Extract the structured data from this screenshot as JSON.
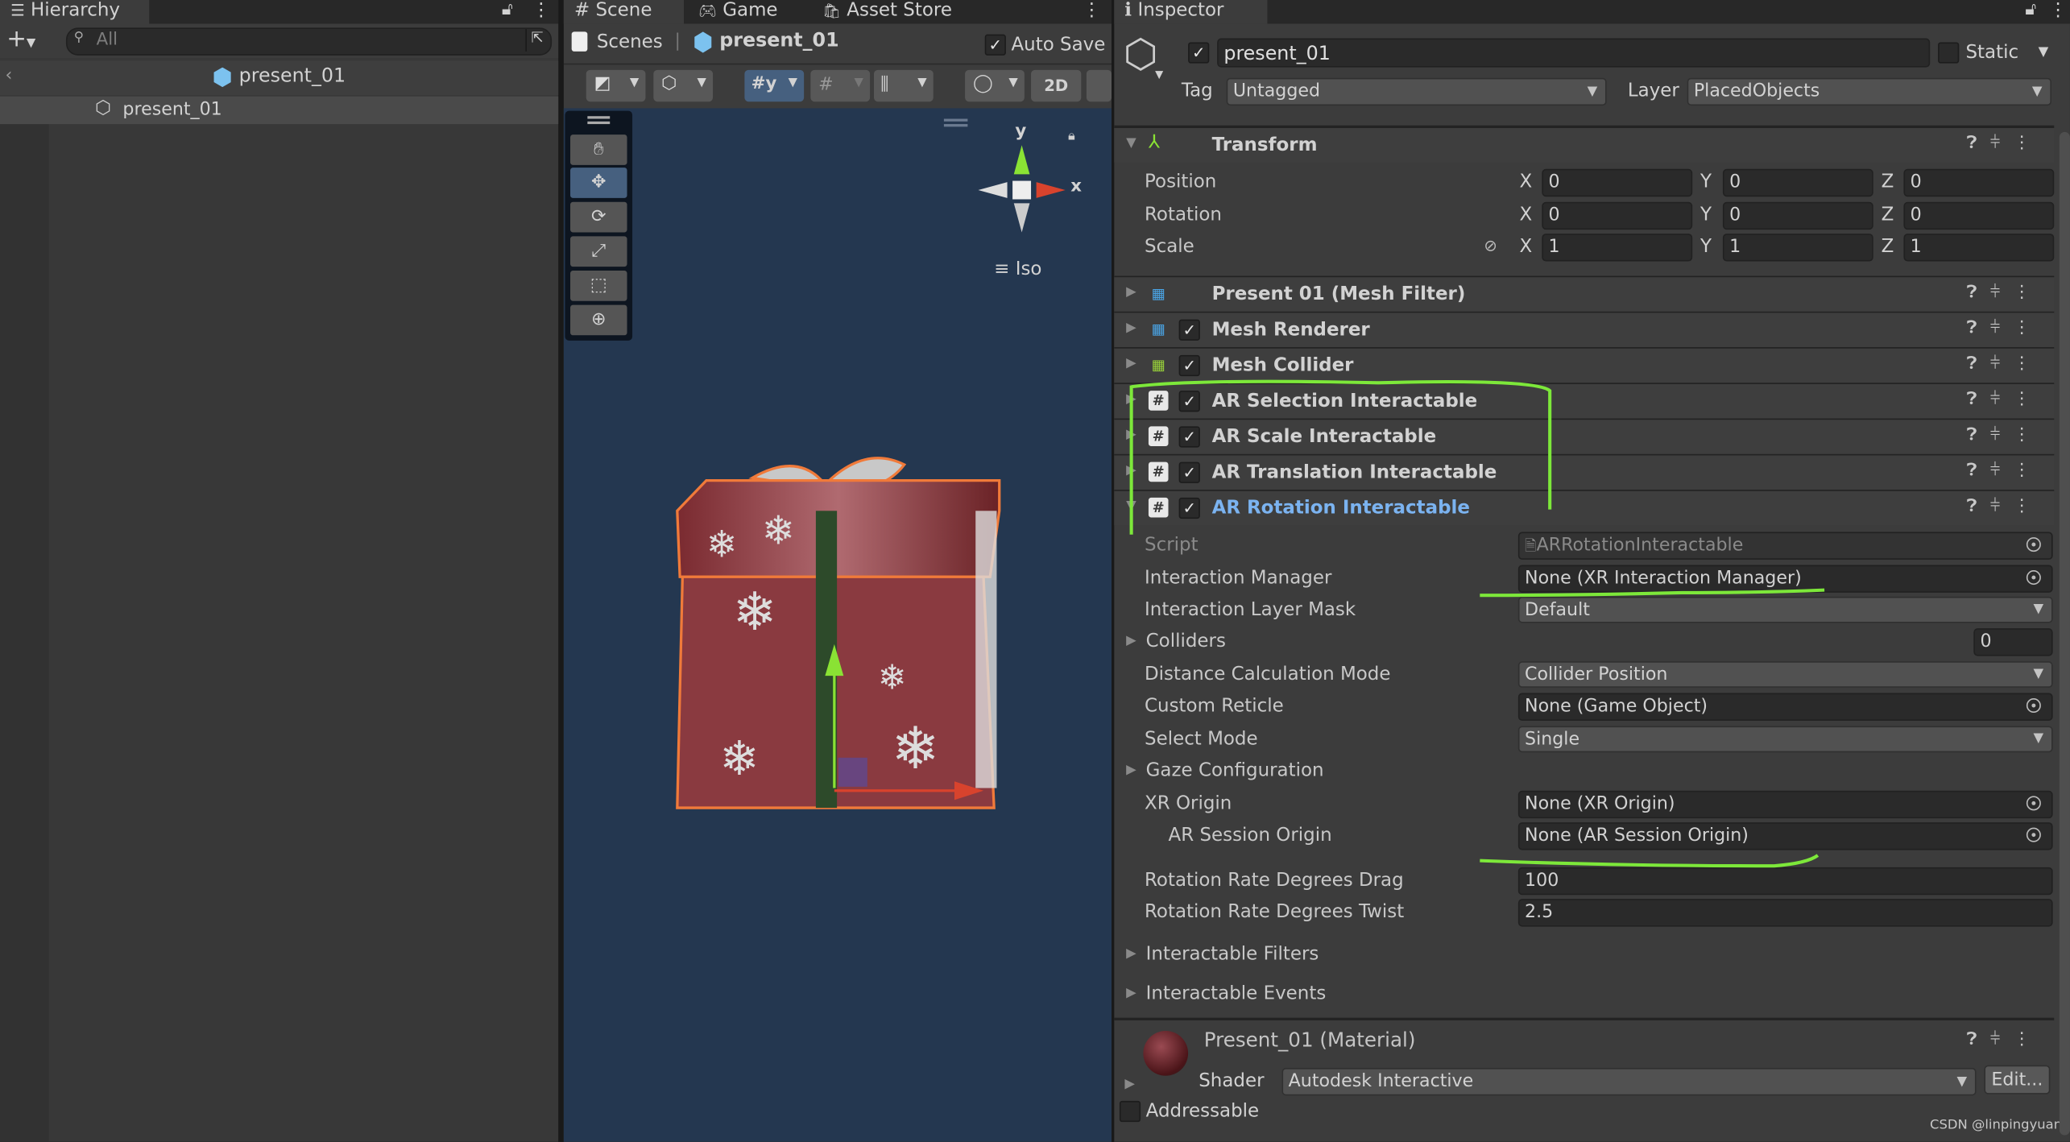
{
  "hierarchy": {
    "tab_label": "Hierarchy",
    "search_placeholder": "All",
    "scene_title": "present_01",
    "items": [
      {
        "label": "present_01",
        "selected": true
      }
    ]
  },
  "scene": {
    "tabs": [
      {
        "label": "Scene",
        "active": true
      },
      {
        "label": "Game",
        "active": false
      },
      {
        "label": "Asset Store",
        "active": false
      }
    ],
    "breadcrumb_root": "Scenes",
    "breadcrumb_prefab": "present_01",
    "auto_save_label": "Auto Save",
    "auto_save_checked": true,
    "toolbar_2d_label": "2D",
    "gizmo_y_label": "y",
    "gizmo_x_label": "x",
    "projection_label": "Iso",
    "tools": [
      "hand-tool",
      "move-tool",
      "rotate-tool",
      "scale-tool",
      "rect-tool",
      "transform-tool"
    ],
    "active_tool": "move-tool"
  },
  "inspector": {
    "tab_label": "Inspector",
    "object_name": "present_01",
    "object_active": true,
    "static_label": "Static",
    "static_checked": false,
    "tag_label": "Tag",
    "tag_value": "Untagged",
    "layer_label": "Layer",
    "layer_value": "PlacedObjects",
    "transform": {
      "title": "Transform",
      "rows": [
        {
          "label": "Position",
          "x": "0",
          "y": "0",
          "z": "0"
        },
        {
          "label": "Rotation",
          "x": "0",
          "y": "0",
          "z": "0"
        },
        {
          "label": "Scale",
          "x": "1",
          "y": "1",
          "z": "1"
        }
      ],
      "axis_labels": [
        "X",
        "Y",
        "Z"
      ]
    },
    "components": [
      {
        "name": "Present 01 (Mesh Filter)",
        "icon": "mesh-filter-icon",
        "has_checkbox": false
      },
      {
        "name": "Mesh Renderer",
        "icon": "mesh-renderer-icon",
        "has_checkbox": true
      },
      {
        "name": "Mesh Collider",
        "icon": "mesh-collider-icon",
        "has_checkbox": true
      },
      {
        "name": "AR Selection Interactable",
        "icon": "script-icon",
        "has_checkbox": true
      },
      {
        "name": "AR Scale Interactable",
        "icon": "script-icon",
        "has_checkbox": true
      },
      {
        "name": "AR Translation Interactable",
        "icon": "script-icon",
        "has_checkbox": true
      },
      {
        "name": "AR Rotation Interactable",
        "icon": "script-icon",
        "has_checkbox": true,
        "expanded": true,
        "highlight": true
      }
    ],
    "rotation_props": [
      {
        "label": "Script",
        "value": "ARRotationInteractable",
        "kind": "script"
      },
      {
        "label": "Interaction Manager",
        "value": "None (XR Interaction Manager)",
        "kind": "object"
      },
      {
        "label": "Interaction Layer Mask",
        "value": "Default",
        "kind": "dropdown"
      },
      {
        "label": "Colliders",
        "value": "0",
        "kind": "foldout-count"
      },
      {
        "label": "Distance Calculation Mode",
        "value": "Collider Position",
        "kind": "dropdown"
      },
      {
        "label": "Custom Reticle",
        "value": "None (Game Object)",
        "kind": "object"
      },
      {
        "label": "Select Mode",
        "value": "Single",
        "kind": "dropdown"
      },
      {
        "label": "Gaze Configuration",
        "value": "",
        "kind": "foldout"
      },
      {
        "label": "XR Origin",
        "value": "None (XR Origin)",
        "kind": "object"
      },
      {
        "label": "AR Session Origin",
        "value": "None (AR Session Origin)",
        "kind": "object-indent"
      },
      {
        "label": "Rotation Rate Degrees Drag",
        "value": "100",
        "kind": "number"
      },
      {
        "label": "Rotation Rate Degrees Twist",
        "value": "2.5",
        "kind": "number"
      },
      {
        "label": "Interactable Filters",
        "value": "",
        "kind": "foldout"
      },
      {
        "label": "Interactable Events",
        "value": "",
        "kind": "foldout"
      }
    ],
    "material": {
      "title": "Present_01 (Material)",
      "shader_label": "Shader",
      "shader_value": "Autodesk Interactive",
      "edit_label": "Edit..."
    },
    "addressable_label": "Addressable",
    "addressable_checked": false
  },
  "watermark": "CSDN @linpingyuan",
  "colors": {
    "accent_blue": "#7bb3f0",
    "annotation_green": "#7de83a",
    "selection_orange": "#f07a3a",
    "viewport_bg": "#243750"
  }
}
